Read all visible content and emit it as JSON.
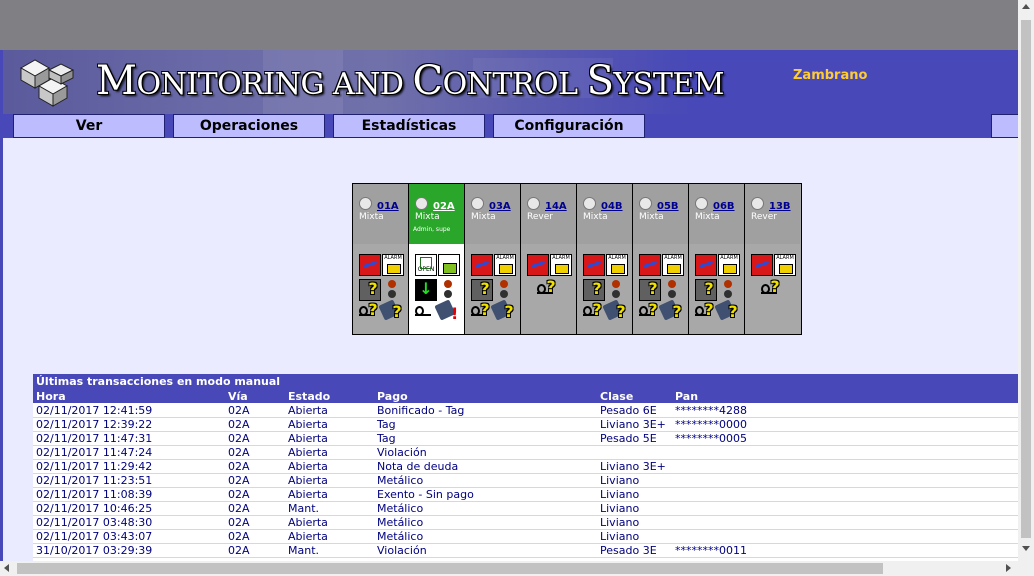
{
  "header": {
    "title_first_M": "M",
    "title_rest1": "ONITORING AND ",
    "title_C": "C",
    "title_rest2": "ONTROL ",
    "title_S": "S",
    "title_rest3": "YSTEM",
    "user": "Zambrano"
  },
  "nav": {
    "items": [
      "Ver",
      "Operaciones",
      "Estadísticas",
      "Configuración"
    ]
  },
  "lanes": [
    {
      "id": "01A",
      "mode": "Mixta",
      "users": "",
      "active": false
    },
    {
      "id": "02A",
      "mode": "Mixta",
      "users": "Admin, supe",
      "active": true
    },
    {
      "id": "03A",
      "mode": "Mixta",
      "users": "",
      "active": false
    },
    {
      "id": "14A",
      "mode": "Rever",
      "users": "",
      "active": false
    },
    {
      "id": "04B",
      "mode": "Mixta",
      "users": "",
      "active": false
    },
    {
      "id": "05B",
      "mode": "Mixta",
      "users": "",
      "active": false
    },
    {
      "id": "06B",
      "mode": "Mixta",
      "users": "",
      "active": false
    },
    {
      "id": "13B",
      "mode": "Rever",
      "users": "",
      "active": false
    }
  ],
  "icons": {
    "alarm_text": "ALARM",
    "open_text": "OPEN",
    "question_mark": "?",
    "arrow_down": "↓",
    "exclamation": "!"
  },
  "transactions": {
    "title": "Últimas transacciones en modo manual",
    "columns": [
      "Hora",
      "Vía",
      "Estado",
      "Pago",
      "Clase",
      "Pan"
    ],
    "rows": [
      [
        "02/11/2017 12:41:59",
        "02A",
        "Abierta",
        "Bonificado - Tag",
        "Pesado 6E",
        "********4288"
      ],
      [
        "02/11/2017 12:39:22",
        "02A",
        "Abierta",
        "Tag",
        "Liviano 3E+",
        "********0000"
      ],
      [
        "02/11/2017 11:47:31",
        "02A",
        "Abierta",
        "Tag",
        "Pesado 5E",
        "********0005"
      ],
      [
        "02/11/2017 11:47:24",
        "02A",
        "Abierta",
        "Violación",
        "",
        ""
      ],
      [
        "02/11/2017 11:29:42",
        "02A",
        "Abierta",
        "Nota de deuda",
        "Liviano 3E+",
        ""
      ],
      [
        "02/11/2017 11:23:51",
        "02A",
        "Abierta",
        "Metálico",
        "Liviano",
        ""
      ],
      [
        "02/11/2017 11:08:39",
        "02A",
        "Abierta",
        "Exento - Sin pago",
        "Liviano",
        ""
      ],
      [
        "02/11/2017 10:46:25",
        "02A",
        "Mant.",
        "Metálico",
        "Liviano",
        ""
      ],
      [
        "02/11/2017 03:48:30",
        "02A",
        "Abierta",
        "Metálico",
        "Liviano",
        ""
      ],
      [
        "02/11/2017 03:43:07",
        "02A",
        "Abierta",
        "Metálico",
        "Liviano",
        ""
      ],
      [
        "31/10/2017 03:29:39",
        "02A",
        "Mant.",
        "Violación",
        "Pesado 3E",
        "********0011"
      ]
    ]
  }
}
